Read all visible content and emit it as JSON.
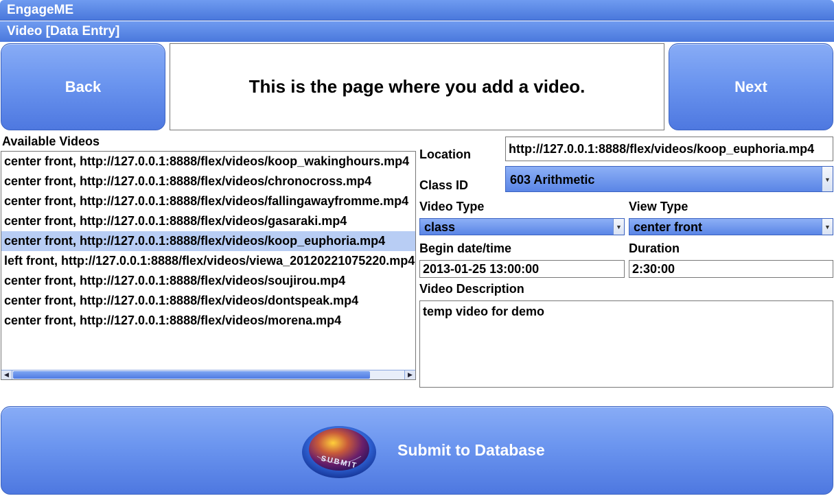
{
  "window": {
    "title": "EngageME"
  },
  "page": {
    "title": "Video [Data Entry]"
  },
  "nav": {
    "back_label": "Back",
    "next_label": "Next"
  },
  "info": {
    "message": "This is the page where you add a video."
  },
  "videos": {
    "label": "Available Videos",
    "items": [
      "center front, http://127.0.0.1:8888/flex/videos/koop_wakinghours.mp4",
      "center front, http://127.0.0.1:8888/flex/videos/chronocross.mp4",
      "center front, http://127.0.0.1:8888/flex/videos/fallingawayfromme.mp4",
      "center front, http://127.0.0.1:8888/flex/videos/gasaraki.mp4",
      "center front, http://127.0.0.1:8888/flex/videos/koop_euphoria.mp4",
      "left front, http://127.0.0.1:8888/flex/videos/viewa_20120221075220.mp4",
      "center front, http://127.0.0.1:8888/flex/videos/soujirou.mp4",
      "center front, http://127.0.0.1:8888/flex/videos/dontspeak.mp4",
      "center front, http://127.0.0.1:8888/flex/videos/morena.mp4"
    ],
    "selected_index": 4
  },
  "form": {
    "location_label": "Location",
    "location_value": "http://127.0.0.1:8888/flex/videos/koop_euphoria.mp4",
    "class_id_label": "Class ID",
    "class_id_value": "603 Arithmetic",
    "video_type_label": "Video Type",
    "video_type_value": "class",
    "view_type_label": "View Type",
    "view_type_value": "center front",
    "begin_label": "Begin date/time",
    "begin_value": "2013-01-25 13:00:00",
    "duration_label": "Duration",
    "duration_value": "2:30:00",
    "description_label": "Video Description",
    "description_value": "temp video for demo"
  },
  "submit": {
    "label": "Submit to Database",
    "icon_text": "SUBMIT"
  },
  "icons": {
    "dropdown": "chevron-down-icon",
    "scroll_left": "arrow-left-icon",
    "scroll_right": "arrow-right-icon",
    "submit": "submit-icon"
  },
  "colors": {
    "accent": "#5a85e6",
    "selected_row": "#b8cdf4"
  }
}
